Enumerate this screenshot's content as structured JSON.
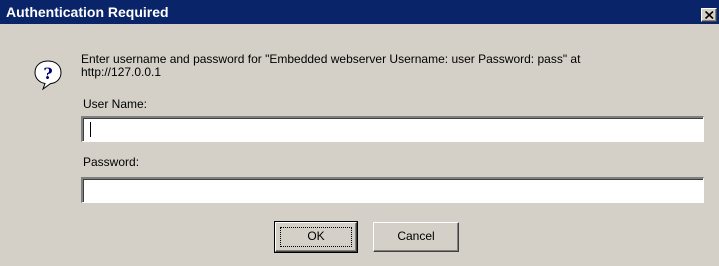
{
  "window": {
    "title": "Authentication Required",
    "close_icon": "close-x-icon"
  },
  "message": {
    "icon": "question-icon",
    "text": "Enter username and password for \"Embedded webserver Username: user Password: pass\" at\nhttp://127.0.0.1"
  },
  "username": {
    "label": "User Name:",
    "value": ""
  },
  "password": {
    "label": "Password:",
    "value": ""
  },
  "buttons": {
    "ok_label": "OK",
    "cancel_label": "Cancel"
  },
  "colors": {
    "titlebar": "#0a246a",
    "dialog_face": "#d4d0c8"
  }
}
